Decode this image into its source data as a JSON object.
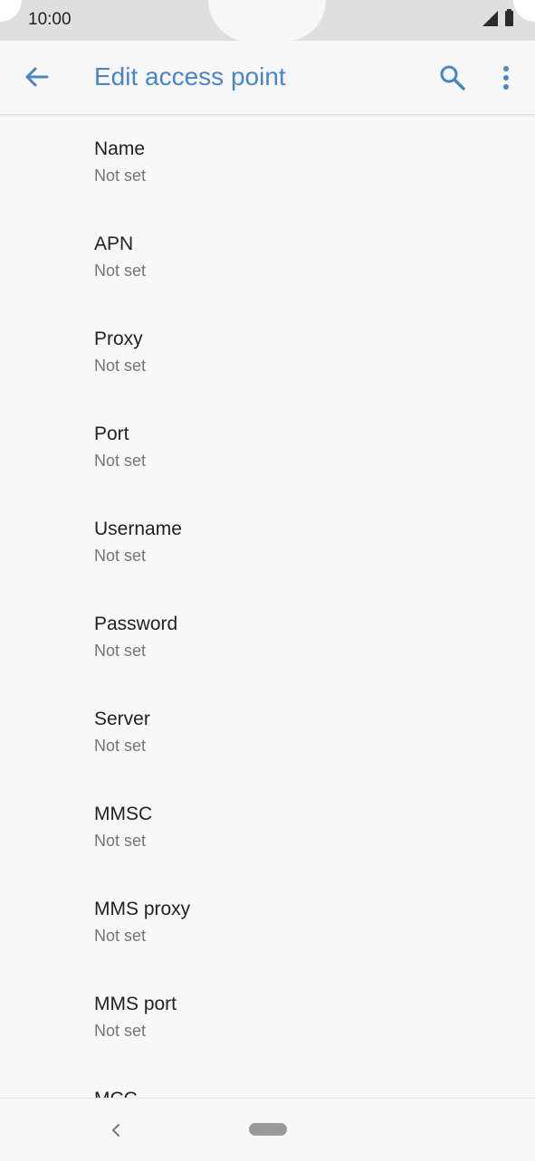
{
  "status_bar": {
    "time": "10:00"
  },
  "app_bar": {
    "title": "Edit access point",
    "icons": {
      "back": "arrow-back-icon",
      "search": "search-icon",
      "more": "more-vert-icon"
    }
  },
  "settings": [
    {
      "title": "Name",
      "value": "Not set"
    },
    {
      "title": "APN",
      "value": "Not set"
    },
    {
      "title": "Proxy",
      "value": "Not set"
    },
    {
      "title": "Port",
      "value": "Not set"
    },
    {
      "title": "Username",
      "value": "Not set"
    },
    {
      "title": "Password",
      "value": "Not set"
    },
    {
      "title": "Server",
      "value": "Not set"
    },
    {
      "title": "MMSC",
      "value": "Not set"
    },
    {
      "title": "MMS proxy",
      "value": "Not set"
    },
    {
      "title": "MMS port",
      "value": "Not set"
    },
    {
      "title": "MCC",
      "value": ""
    }
  ],
  "colors": {
    "accent": "#4a86c6",
    "background": "#f8f8f8",
    "text_primary": "#222222",
    "text_secondary": "#757575"
  }
}
